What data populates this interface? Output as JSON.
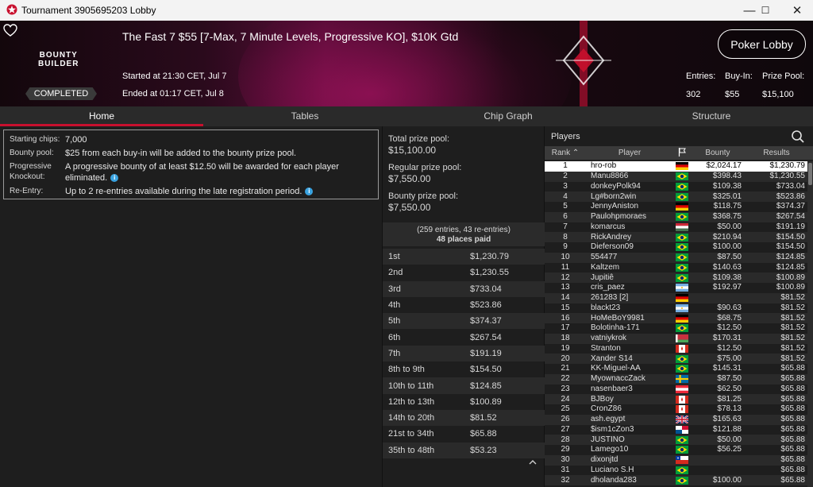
{
  "window": {
    "title": "Tournament 3905695203 Lobby",
    "minimize": "—",
    "maximize": "☐",
    "close": "✕"
  },
  "banner": {
    "tournament_name": "The Fast 7 $55 [7-Max, 7 Minute Levels, Progressive KO], $10K Gtd",
    "brand_line1": "BOUNTY",
    "brand_line2": "BUILDER",
    "status_badge": "COMPLETED",
    "started": "Started at 21:30 CET, Jul 7",
    "ended": "Ended at 01:17 CET, Jul 8",
    "lobby_button": "Poker Lobby",
    "entries_label": "Entries:",
    "entries_value": "302",
    "buyin_label": "Buy-In:",
    "buyin_value": "$55",
    "prizepool_label": "Prize Pool:",
    "prizepool_value": "$15,100"
  },
  "tabs": [
    "Home",
    "Tables",
    "Chip Graph",
    "Structure"
  ],
  "info": {
    "starting_chips_label": "Starting chips:",
    "starting_chips": "7,000",
    "bounty_pool_label": "Bounty pool:",
    "bounty_pool": "$25 from each buy-in will be added to the bounty prize pool.",
    "pko_label": "Progressive Knockout:",
    "pko": "A progressive bounty of at least $12.50 will be awarded for each player eliminated.",
    "reentry_label": "Re-Entry:",
    "reentry": "Up to 2 re-entries available during the late registration period."
  },
  "prizes": {
    "total_label": "Total prize pool:",
    "total": "$15,100.00",
    "regular_label": "Regular prize pool:",
    "regular": "$7,550.00",
    "bounty_label": "Bounty prize pool:",
    "bounty": "$7,550.00",
    "entries_line": "(259 entries, 43 re-entries)",
    "paid_line": "48 places paid",
    "places": [
      {
        "place": "1st",
        "amount": "$1,230.79"
      },
      {
        "place": "2nd",
        "amount": "$1,230.55"
      },
      {
        "place": "3rd",
        "amount": "$733.04"
      },
      {
        "place": "4th",
        "amount": "$523.86"
      },
      {
        "place": "5th",
        "amount": "$374.37"
      },
      {
        "place": "6th",
        "amount": "$267.54"
      },
      {
        "place": "7th",
        "amount": "$191.19"
      },
      {
        "place": "8th to 9th",
        "amount": "$154.50"
      },
      {
        "place": "10th to 11th",
        "amount": "$124.85"
      },
      {
        "place": "12th to 13th",
        "amount": "$100.89"
      },
      {
        "place": "14th to 20th",
        "amount": "$81.52"
      },
      {
        "place": "21st to 34th",
        "amount": "$65.88"
      },
      {
        "place": "35th to 48th",
        "amount": "$53.23"
      }
    ],
    "collapse_icon": "chevron-up-icon"
  },
  "players": {
    "title": "Players",
    "columns": {
      "rank": "Rank",
      "player": "Player",
      "bounty": "Bounty",
      "results": "Results"
    },
    "rows": [
      {
        "rank": "1",
        "name": "hro-rob",
        "flag": "de",
        "bounty": "$2,024.17",
        "result": "$1,230.79"
      },
      {
        "rank": "2",
        "name": "Manu8866",
        "flag": "br",
        "bounty": "$398.43",
        "result": "$1,230.55"
      },
      {
        "rank": "3",
        "name": "donkeyPolk94",
        "flag": "br",
        "bounty": "$109.38",
        "result": "$733.04"
      },
      {
        "rank": "4",
        "name": "Lg#born2win",
        "flag": "br",
        "bounty": "$325.01",
        "result": "$523.86"
      },
      {
        "rank": "5",
        "name": "JennyAniston",
        "flag": "de",
        "bounty": "$118.75",
        "result": "$374.37"
      },
      {
        "rank": "6",
        "name": "Paulohpmoraes",
        "flag": "br",
        "bounty": "$368.75",
        "result": "$267.54"
      },
      {
        "rank": "7",
        "name": "komarcus",
        "flag": "hu",
        "bounty": "$50.00",
        "result": "$191.19"
      },
      {
        "rank": "8",
        "name": "RickAndrey",
        "flag": "br",
        "bounty": "$210.94",
        "result": "$154.50"
      },
      {
        "rank": "9",
        "name": "Dieferson09",
        "flag": "br",
        "bounty": "$100.00",
        "result": "$154.50"
      },
      {
        "rank": "10",
        "name": "554477",
        "flag": "br",
        "bounty": "$87.50",
        "result": "$124.85"
      },
      {
        "rank": "11",
        "name": "Kaltzem",
        "flag": "br",
        "bounty": "$140.63",
        "result": "$124.85"
      },
      {
        "rank": "12",
        "name": "Jupitiê",
        "flag": "br",
        "bounty": "$109.38",
        "result": "$100.89"
      },
      {
        "rank": "13",
        "name": "cris_paez",
        "flag": "ar",
        "bounty": "$192.97",
        "result": "$100.89"
      },
      {
        "rank": "14",
        "name": "261283 [2]",
        "flag": "de",
        "bounty": "",
        "result": "$81.52"
      },
      {
        "rank": "15",
        "name": "blackt23",
        "flag": "ar",
        "bounty": "$90.63",
        "result": "$81.52"
      },
      {
        "rank": "16",
        "name": "HoMeBoY9981",
        "flag": "de",
        "bounty": "$68.75",
        "result": "$81.52"
      },
      {
        "rank": "17",
        "name": "Bolotinha-171",
        "flag": "br",
        "bounty": "$12.50",
        "result": "$81.52"
      },
      {
        "rank": "18",
        "name": "vatniykrok",
        "flag": "by",
        "bounty": "$170.31",
        "result": "$81.52"
      },
      {
        "rank": "19",
        "name": "Stranton",
        "flag": "ca",
        "bounty": "$12.50",
        "result": "$81.52"
      },
      {
        "rank": "20",
        "name": "Xander S14",
        "flag": "br",
        "bounty": "$75.00",
        "result": "$81.52"
      },
      {
        "rank": "21",
        "name": "KK-Miguel-AA",
        "flag": "br",
        "bounty": "$145.31",
        "result": "$65.88"
      },
      {
        "rank": "22",
        "name": "MyownaccZack",
        "flag": "se",
        "bounty": "$87.50",
        "result": "$65.88"
      },
      {
        "rank": "23",
        "name": "nasenbaer3",
        "flag": "at",
        "bounty": "$62.50",
        "result": "$65.88"
      },
      {
        "rank": "24",
        "name": "BJBoy",
        "flag": "ca",
        "bounty": "$81.25",
        "result": "$65.88"
      },
      {
        "rank": "25",
        "name": "CronZ86",
        "flag": "ca",
        "bounty": "$78.13",
        "result": "$65.88"
      },
      {
        "rank": "26",
        "name": "ash.egypt",
        "flag": "gb",
        "bounty": "$165.63",
        "result": "$65.88"
      },
      {
        "rank": "27",
        "name": "$ism1cZon3",
        "flag": "pa",
        "bounty": "$121.88",
        "result": "$65.88"
      },
      {
        "rank": "28",
        "name": "JUSTINO",
        "flag": "br",
        "bounty": "$50.00",
        "result": "$65.88"
      },
      {
        "rank": "29",
        "name": "Lamego10",
        "flag": "br",
        "bounty": "$56.25",
        "result": "$65.88"
      },
      {
        "rank": "30",
        "name": "dixonjtd",
        "flag": "cl",
        "bounty": "",
        "result": "$65.88"
      },
      {
        "rank": "31",
        "name": "Luciano S.H",
        "flag": "br",
        "bounty": "",
        "result": "$65.88"
      },
      {
        "rank": "32",
        "name": "dholanda283",
        "flag": "br",
        "bounty": "$100.00",
        "result": "$65.88"
      }
    ]
  },
  "colors": {
    "accent": "#c8102e",
    "panel": "#1e1e1e",
    "stripe": "#2a2a2a"
  }
}
